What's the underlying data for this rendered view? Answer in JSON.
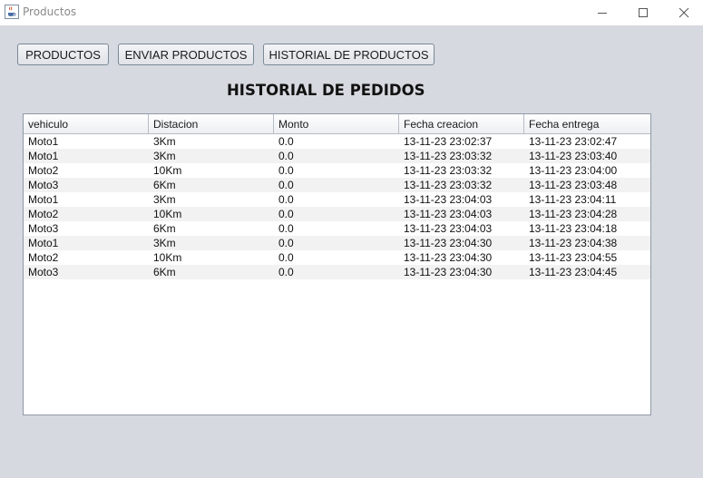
{
  "window": {
    "title": "Productos",
    "icon": "java-cup-icon"
  },
  "nav": {
    "productos_label": "PRODUCTOS",
    "enviar_label": "ENVIAR PRODUCTOS",
    "historial_label": "HISTORIAL DE PRODUCTOS"
  },
  "heading": "HISTORIAL DE PEDIDOS",
  "table": {
    "columns": [
      "vehiculo",
      "Distacion",
      "Monto",
      "Fecha creacion",
      "Fecha entrega"
    ],
    "rows": [
      [
        "Moto1",
        "3Km",
        "0.0",
        "13-11-23 23:02:37",
        "13-11-23 23:02:47"
      ],
      [
        "Moto1",
        "3Km",
        "0.0",
        "13-11-23 23:03:32",
        "13-11-23 23:03:40"
      ],
      [
        "Moto2",
        "10Km",
        "0.0",
        "13-11-23 23:03:32",
        "13-11-23 23:04:00"
      ],
      [
        "Moto3",
        "6Km",
        "0.0",
        "13-11-23 23:03:32",
        "13-11-23 23:03:48"
      ],
      [
        "Moto1",
        "3Km",
        "0.0",
        "13-11-23 23:04:03",
        "13-11-23 23:04:11"
      ],
      [
        "Moto2",
        "10Km",
        "0.0",
        "13-11-23 23:04:03",
        "13-11-23 23:04:28"
      ],
      [
        "Moto3",
        "6Km",
        "0.0",
        "13-11-23 23:04:03",
        "13-11-23 23:04:18"
      ],
      [
        "Moto1",
        "3Km",
        "0.0",
        "13-11-23 23:04:30",
        "13-11-23 23:04:38"
      ],
      [
        "Moto2",
        "10Km",
        "0.0",
        "13-11-23 23:04:30",
        "13-11-23 23:04:55"
      ],
      [
        "Moto3",
        "6Km",
        "0.0",
        "13-11-23 23:04:30",
        "13-11-23 23:04:45"
      ]
    ]
  }
}
